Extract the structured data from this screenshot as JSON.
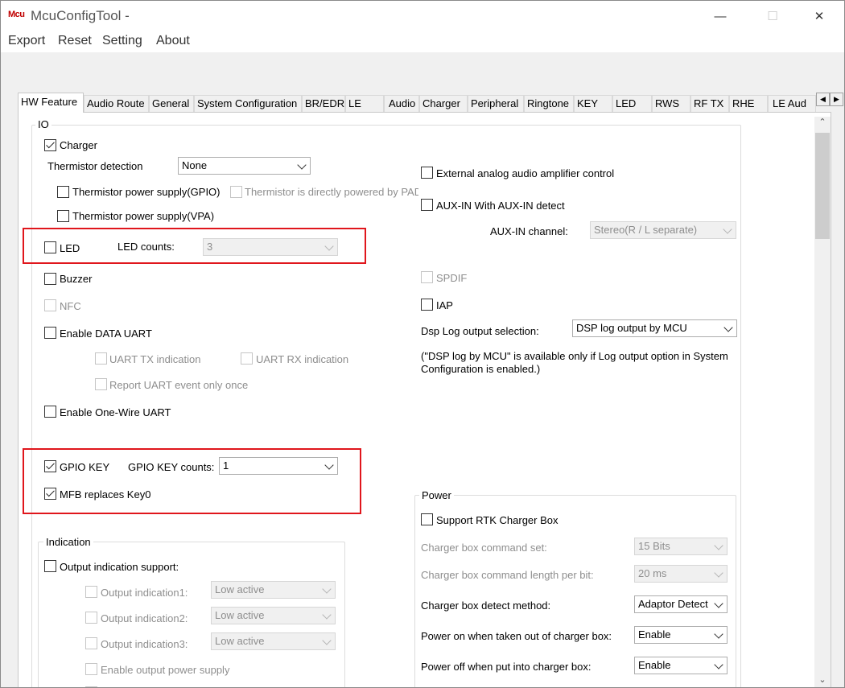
{
  "window": {
    "title": "McuConfigTool -",
    "icon_text_red": "Mcu",
    "icon_name": "app-logo-icon",
    "minimize_glyph": "—",
    "maximize_glyph": "☐",
    "close_glyph": "✕"
  },
  "menu": {
    "export": "Export",
    "reset": "Reset",
    "setting": "Setting",
    "about": "About"
  },
  "tabs": [
    "HW Feature",
    "Audio Route",
    "General",
    "System Configuration",
    "BR/EDR",
    "LE",
    "Audio",
    "Charger",
    "Peripheral",
    "Ringtone",
    "KEY",
    "LED",
    "RWS",
    "RF TX",
    "RHE",
    "LE Aud"
  ],
  "tab_scroll": {
    "left": "◀",
    "right": "▶"
  },
  "io": {
    "label": "IO",
    "charger": "Charger",
    "thermistor_detection": "Thermistor detection",
    "thermistor_value": "None",
    "thermistor_gpio": "Thermistor power supply(GPIO)",
    "thermistor_pad": "Thermistor is directly powered by PAD",
    "thermistor_vpa": "Thermistor power supply(VPA)",
    "led": "LED",
    "led_counts": "LED counts:",
    "led_counts_value": "3",
    "buzzer": "Buzzer",
    "nfc": "NFC",
    "data_uart": "Enable DATA UART",
    "uart_tx": "UART TX indication",
    "uart_rx": "UART RX indication",
    "uart_once": "Report UART event only once",
    "one_wire": "Enable One-Wire UART",
    "gpio_key": "GPIO KEY",
    "gpio_key_counts": "GPIO KEY counts:",
    "gpio_key_counts_value": "1",
    "mfb": "MFB replaces Key0",
    "ext_amp": "External analog audio amplifier control",
    "aux_in": "AUX-IN With AUX-IN detect",
    "aux_channel": "AUX-IN channel:",
    "aux_channel_value": "Stereo(R / L separate)",
    "spdif": "SPDIF",
    "iap": "IAP",
    "dsp_log": "Dsp Log output selection:",
    "dsp_log_value": "DSP log output by MCU",
    "dsp_note_1": "(\"DSP log by MCU\" is available only if Log output option in System",
    "dsp_note_2": "Configuration is enabled.)"
  },
  "indication": {
    "label": "Indication",
    "support": "Output indication support:",
    "out1": "Output indication1:",
    "out2": "Output indication2:",
    "out3": "Output indication3:",
    "low_active": "Low active",
    "power_supply": "Enable output power supply"
  },
  "power": {
    "label": "Power",
    "rtk_box": "Support RTK Charger Box",
    "cmd_set": "Charger box command set:",
    "cmd_set_value": "15 Bits",
    "cmd_len": "Charger box command length per bit:",
    "cmd_len_value": "20 ms",
    "detect": "Charger box detect method:",
    "detect_value": "Adaptor Detect",
    "power_on": "Power on when taken out of charger box:",
    "power_on_value": "Enable",
    "power_off": "Power off when put into charger box:",
    "power_off_value": "Enable"
  },
  "scroll": {
    "up": "⌃",
    "down": "⌄"
  },
  "colors": {
    "highlight_box": "#e0161c",
    "tab_bg": "#f0f0f0"
  }
}
